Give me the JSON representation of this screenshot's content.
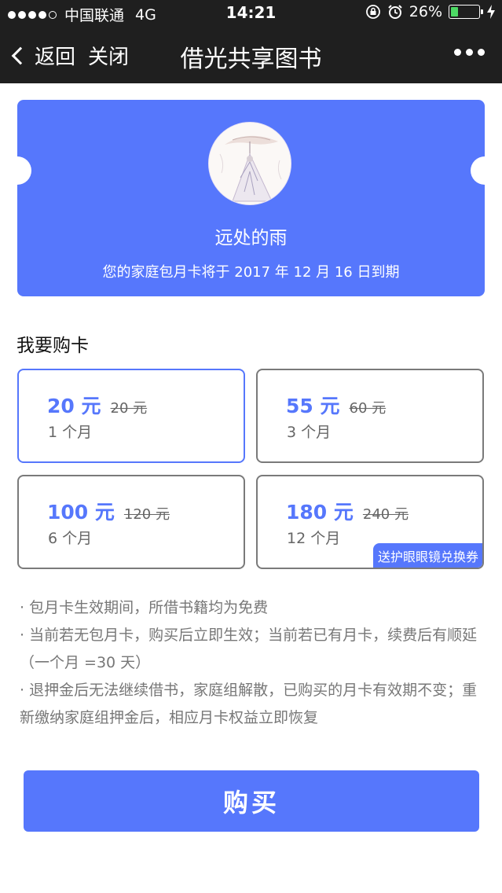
{
  "status_bar": {
    "carrier": "中国联通",
    "network": "4G",
    "time": "14:21",
    "battery": "26%",
    "battery_level": 0.26,
    "icons": [
      "signal-dots-icon",
      "rotation-lock-icon",
      "alarm-icon",
      "battery-icon",
      "charging-bolt-icon"
    ]
  },
  "nav": {
    "back_label": "返回",
    "close_label": "关闭",
    "title": "借光共享图书",
    "more_icon": "more-dots-icon"
  },
  "profile": {
    "username": "远处的雨",
    "expire_text": "您的家庭包月卡将于 2017 年 12 月 16 日到期"
  },
  "section_title": "我要购卡",
  "plans": [
    {
      "price": "20 元",
      "original": "20 元",
      "duration": "1 个月",
      "selected": true
    },
    {
      "price": "55 元",
      "original": "60 元",
      "duration": "3 个月",
      "selected": false
    },
    {
      "price": "100 元",
      "original": "120 元",
      "duration": "6 个月",
      "selected": false
    },
    {
      "price": "180 元",
      "original": "240 元",
      "duration": "12 个月",
      "selected": false,
      "badge": "送护眼眼镜兑换券"
    }
  ],
  "notes": [
    "· 包月卡生效期间，所借书籍均为免费",
    "· 当前若无包月卡，购买后立即生效；当前若已有月卡，续费后有顺延（一个月 =30 天）",
    "· 退押金后无法继续借书，家庭组解散，已购买的月卡有效期不变；重新缴纳家庭组押金后，相应月卡权益立即恢复"
  ],
  "buy_label": "购买",
  "colors": {
    "accent": "#5677fc",
    "header_bg": "#1f1f1f",
    "battery_green": "#4cd964"
  }
}
